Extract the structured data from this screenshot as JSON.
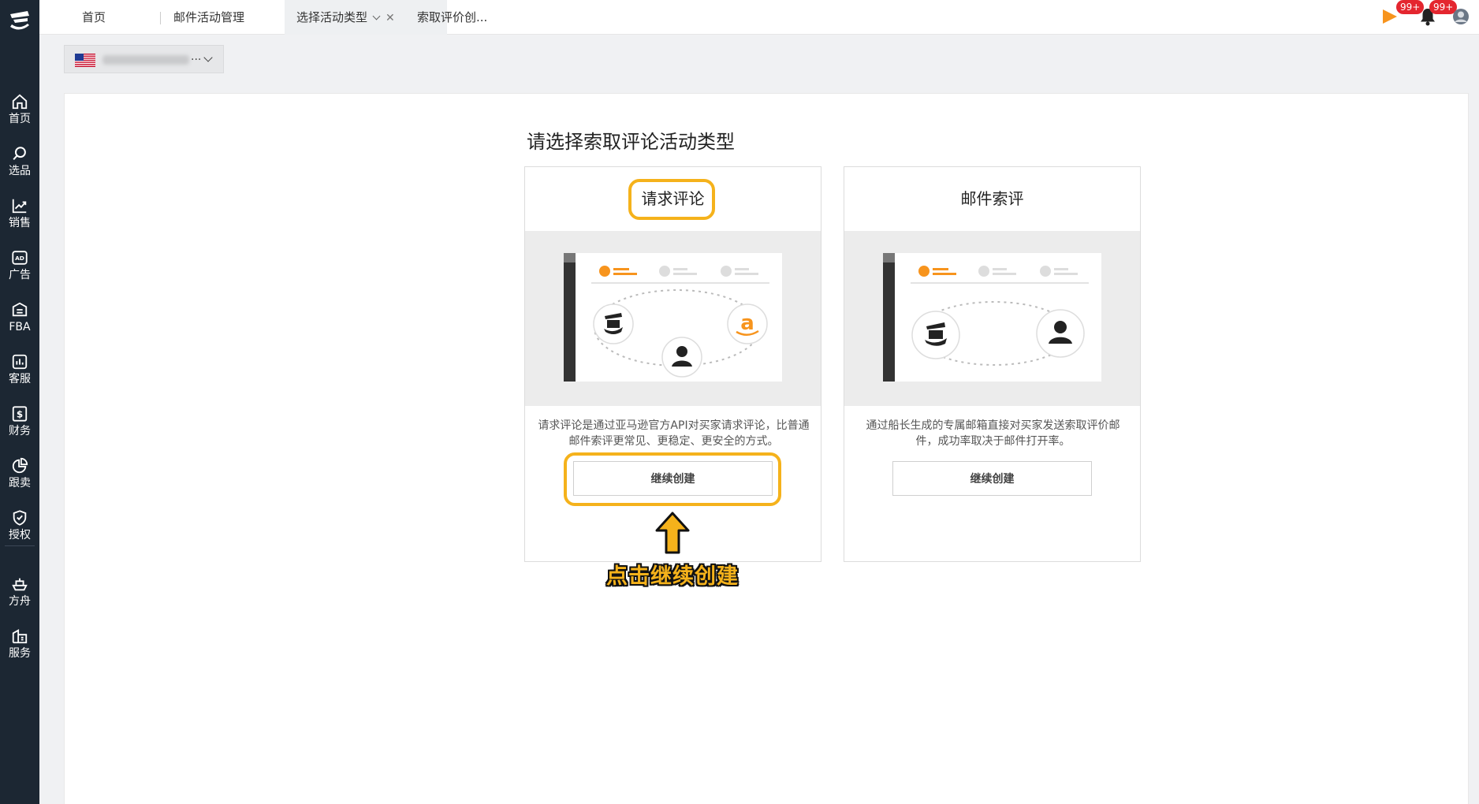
{
  "sidebar": {
    "items": [
      {
        "label": "首页",
        "icon": "home-icon"
      },
      {
        "label": "选品",
        "icon": "search-icon"
      },
      {
        "label": "销售",
        "icon": "trend-chart-icon"
      },
      {
        "label": "广告",
        "icon": "ad-icon"
      },
      {
        "label": "FBA",
        "icon": "fba-icon"
      },
      {
        "label": "客服",
        "icon": "bar-chart-icon"
      },
      {
        "label": "财务",
        "icon": "dollar-icon"
      },
      {
        "label": "跟卖",
        "icon": "pie-chart-icon"
      },
      {
        "label": "授权",
        "icon": "shield-check-icon"
      },
      {
        "label": "方舟",
        "icon": "ark-icon"
      },
      {
        "label": "服务",
        "icon": "building-icon"
      }
    ]
  },
  "tabs": [
    {
      "label": "首页"
    },
    {
      "label": "邮件活动管理"
    },
    {
      "label": "选择活动类型",
      "active": true
    },
    {
      "label": "索取评价创..."
    }
  ],
  "header": {
    "notifications_badge": "99+",
    "messages_badge": "99+"
  },
  "store": {
    "ellipsis": "..."
  },
  "page": {
    "title": "请选择索取评论活动类型"
  },
  "cards": [
    {
      "title": "请求评论",
      "description": "请求评论是通过亚马逊官方API对买家请求评论，比普通邮件索评更常见、更稳定、更安全的方式。",
      "button": "继续创建"
    },
    {
      "title": "邮件索评",
      "description": "通过船长生成的专属邮箱直接对买家发送索取评价邮件，成功率取决于邮件打开率。",
      "button": "继续创建"
    }
  ],
  "annotation": {
    "text": "点击继续创建"
  },
  "colors": {
    "sidebar_bg": "#1c2733",
    "highlight": "#f5b21b",
    "accent_orange": "#f7941d",
    "badge_red": "#e4262f"
  }
}
